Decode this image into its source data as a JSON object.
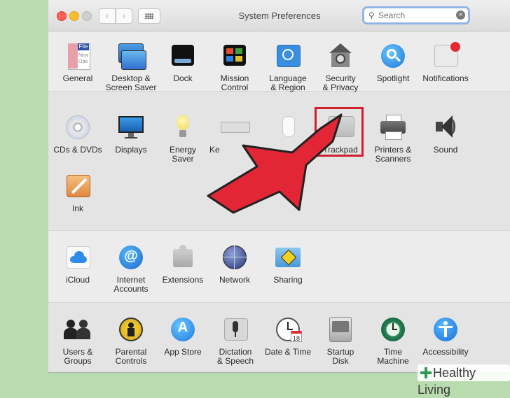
{
  "window": {
    "title": "System Preferences"
  },
  "search": {
    "placeholder": "Search",
    "value": ""
  },
  "colors": {
    "highlight": "#d0202e",
    "arrow": "#e32636",
    "background": "#b9dcae"
  },
  "rows": [
    [
      {
        "id": "general",
        "label": "General",
        "icon": "general-icon"
      },
      {
        "id": "desktop",
        "label": "Desktop &\nScreen Saver",
        "icon": "desktop-icon"
      },
      {
        "id": "dock",
        "label": "Dock",
        "icon": "dock-icon"
      },
      {
        "id": "mission",
        "label": "Mission\nControl",
        "icon": "mission-control-icon"
      },
      {
        "id": "language",
        "label": "Language\n& Region",
        "icon": "globe-flag-icon"
      },
      {
        "id": "security",
        "label": "Security\n& Privacy",
        "icon": "security-house-icon"
      },
      {
        "id": "spotlight",
        "label": "Spotlight",
        "icon": "spotlight-icon"
      },
      {
        "id": "notifications",
        "label": "Notifications",
        "icon": "notifications-icon"
      }
    ],
    [
      {
        "id": "cds",
        "label": "CDs & DVDs",
        "icon": "disc-icon"
      },
      {
        "id": "displays",
        "label": "Displays",
        "icon": "display-icon"
      },
      {
        "id": "energy",
        "label": "Energy\nSaver",
        "icon": "lightbulb-icon"
      },
      {
        "id": "keyboard",
        "label": "Ke",
        "icon": "keyboard-icon"
      },
      {
        "id": "mouse",
        "label": "",
        "icon": "mouse-icon"
      },
      {
        "id": "trackpad",
        "label": "Trackpad",
        "icon": "trackpad-icon"
      },
      {
        "id": "printers",
        "label": "Printers &\nScanners",
        "icon": "printer-icon"
      },
      {
        "id": "sound",
        "label": "Sound",
        "icon": "speaker-icon"
      },
      {
        "id": "ink",
        "label": "Ink",
        "icon": "ink-pen-icon"
      }
    ],
    [
      {
        "id": "icloud",
        "label": "iCloud",
        "icon": "cloud-icon"
      },
      {
        "id": "internet",
        "label": "Internet\nAccounts",
        "icon": "at-sign-icon"
      },
      {
        "id": "extensions",
        "label": "Extensions",
        "icon": "puzzle-icon"
      },
      {
        "id": "network",
        "label": "Network",
        "icon": "network-globe-icon"
      },
      {
        "id": "sharing",
        "label": "Sharing",
        "icon": "sharing-folder-icon"
      }
    ],
    [
      {
        "id": "users",
        "label": "Users &\nGroups",
        "icon": "users-icon"
      },
      {
        "id": "parental",
        "label": "Parental\nControls",
        "icon": "parental-icon"
      },
      {
        "id": "appstore",
        "label": "App Store",
        "icon": "app-store-icon"
      },
      {
        "id": "dictation",
        "label": "Dictation\n& Speech",
        "icon": "microphone-icon"
      },
      {
        "id": "datetime",
        "label": "Date & Time",
        "icon": "clock-calendar-icon"
      },
      {
        "id": "startup",
        "label": "Startup\nDisk",
        "icon": "hard-disk-icon"
      },
      {
        "id": "timemachine",
        "label": "Time\nMachine",
        "icon": "time-machine-icon"
      },
      {
        "id": "accessibility",
        "label": "Accessibility",
        "icon": "accessibility-icon"
      }
    ]
  ],
  "general_icon_text": {
    "file": "File",
    "new": "New",
    "open": "Ope"
  },
  "calendar_icon_text": {
    "day": "18"
  },
  "watermark": {
    "text": "Healthy Living"
  }
}
